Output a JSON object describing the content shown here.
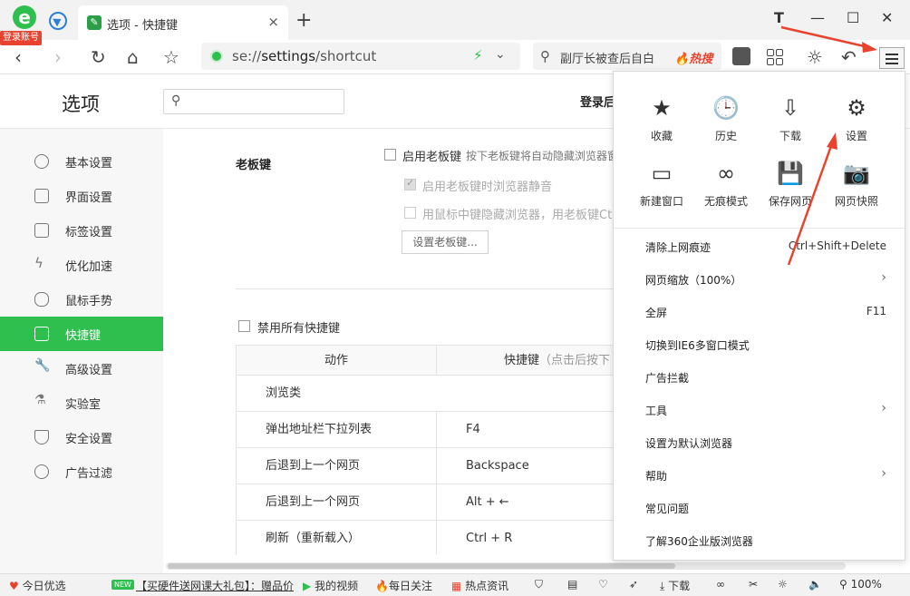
{
  "titlebar": {
    "login_badge": "登录账号",
    "tab_title": "选项 - 快捷键",
    "tab_close": "×",
    "new_tab": "+",
    "minimize": "—",
    "maximize": "☐",
    "close": "✕",
    "skin_icon": "T"
  },
  "toolbar": {
    "url_scheme": "se://",
    "url_main": "settings",
    "url_rest": "/shortcut",
    "search_text": "副厅长被查后自白",
    "hot_tag": "热搜"
  },
  "options": {
    "title": "选项",
    "search_placeholder": "",
    "login_text": "登录后"
  },
  "sidebar": {
    "items": [
      {
        "label": "基本设置",
        "icon": "gear-icon"
      },
      {
        "label": "界面设置",
        "icon": "window-icon"
      },
      {
        "label": "标签设置",
        "icon": "tab-icon"
      },
      {
        "label": "优化加速",
        "icon": "bolt-icon"
      },
      {
        "label": "鼠标手势",
        "icon": "mouse-icon"
      },
      {
        "label": "快捷键",
        "icon": "keyboard-icon",
        "active": true
      },
      {
        "label": "高级设置",
        "icon": "wrench-icon"
      },
      {
        "label": "实验室",
        "icon": "flask-icon"
      },
      {
        "label": "安全设置",
        "icon": "shield-icon"
      },
      {
        "label": "广告过滤",
        "icon": "block-icon"
      }
    ]
  },
  "boss_key": {
    "section_label": "老板键",
    "enable_label": "启用老板键",
    "enable_hint": "按下老板键将自动隐藏浏览器窗",
    "mute_label": "启用老板键时浏览器静音",
    "middle_label": "用鼠标中键隐藏浏览器，用老板键Ctrl+",
    "set_button": "设置老板键..."
  },
  "shortcuts": {
    "disable_all_label": "禁用所有快捷键",
    "col_action": "动作",
    "col_key": "快捷键",
    "col_key_hint": "（点击后按下",
    "group": "浏览类",
    "rows": [
      {
        "action": "弹出地址栏下拉列表",
        "key": "F4"
      },
      {
        "action": "后退到上一个网页",
        "key": "Backspace"
      },
      {
        "action": "后退到上一个网页",
        "key": "Alt + ←"
      },
      {
        "action": "刷新（重新载入）",
        "key": "Ctrl + R"
      }
    ]
  },
  "menu": {
    "grid": [
      {
        "label": "收藏",
        "icon": "★"
      },
      {
        "label": "历史",
        "icon": "🕒"
      },
      {
        "label": "下载",
        "icon": "⇩"
      },
      {
        "label": "设置",
        "icon": "⚙"
      },
      {
        "label": "新建窗口",
        "icon": "▭"
      },
      {
        "label": "无痕模式",
        "icon": "∞"
      },
      {
        "label": "保存网页",
        "icon": "💾"
      },
      {
        "label": "网页快照",
        "icon": "📷"
      }
    ],
    "items": [
      {
        "label": "清除上网痕迹",
        "shortcut": "Ctrl+Shift+Delete",
        "arrow": ""
      },
      {
        "label": "网页缩放（100%）",
        "shortcut": "",
        "arrow": "›"
      },
      {
        "label": "全屏",
        "shortcut": "F11",
        "arrow": ""
      },
      {
        "label": "切换到IE6多窗口模式",
        "shortcut": "",
        "arrow": ""
      },
      {
        "label": "广告拦截",
        "shortcut": "",
        "arrow": ""
      },
      {
        "label": "工具",
        "shortcut": "",
        "arrow": "›"
      },
      {
        "label": "设置为默认浏览器",
        "shortcut": "",
        "arrow": ""
      },
      {
        "label": "帮助",
        "shortcut": "",
        "arrow": "›"
      },
      {
        "label": "常见问题",
        "shortcut": "",
        "arrow": ""
      },
      {
        "label": "了解360企业版浏览器",
        "shortcut": "",
        "arrow": ""
      }
    ]
  },
  "statusbar": {
    "today": "今日优选",
    "new_badge": "NEW",
    "promo": "【买硬件送网课大礼包】：赠品价",
    "my_video": "我的视频",
    "daily": "每日关注",
    "hot_news": "热点资讯",
    "download": "下载",
    "zoom": "100%"
  },
  "colors": {
    "accent": "#2fbf4f",
    "annotation": "#e8432f"
  }
}
